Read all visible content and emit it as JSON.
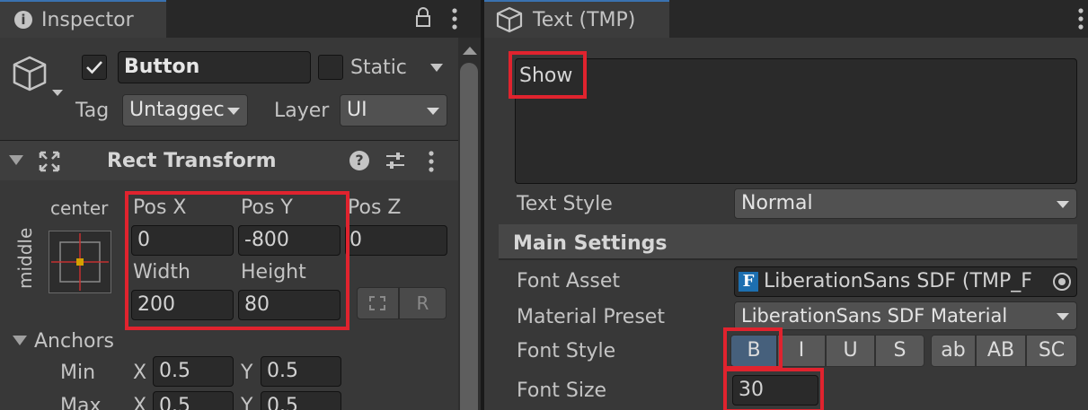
{
  "left_panel": {
    "tab_title": "Inspector",
    "object_name": "Button",
    "static_label": "Static",
    "tag_label": "Tag",
    "tag_value": "Untaggec",
    "layer_label": "Layer",
    "layer_value": "UI",
    "component_title": "Rect Transform",
    "anchor_h_label": "center",
    "anchor_v_label": "middle",
    "posx_label": "Pos X",
    "posx_value": "0",
    "posy_label": "Pos Y",
    "posy_value": "-800",
    "posz_label": "Pos Z",
    "posz_value": "0",
    "width_label": "Width",
    "width_value": "200",
    "height_label": "Height",
    "height_value": "80",
    "r_button_label": "R",
    "anchors_label": "Anchors",
    "min_label": "Min",
    "min_x_label": "X",
    "min_x_value": "0.5",
    "min_y_label": "Y",
    "min_y_value": "0.5",
    "max_label": "Max",
    "max_x_label": "X",
    "max_x_value": "0.5",
    "max_y_label": "Y",
    "max_y_value": "0.5"
  },
  "right_panel": {
    "tab_title": "Text (TMP)",
    "text_content": "Show",
    "text_style_label": "Text Style",
    "text_style_value": "Normal",
    "main_settings_label": "Main Settings",
    "font_asset_label": "Font Asset",
    "font_asset_icon_glyph": "F",
    "font_asset_value": "LiberationSans SDF (TMP_F",
    "material_preset_label": "Material Preset",
    "material_preset_value": "LiberationSans SDF Material",
    "font_style_label": "Font Style",
    "style_buttons": [
      "B",
      "I",
      "U",
      "S",
      "ab",
      "AB",
      "SC"
    ],
    "font_size_label": "Font Size",
    "font_size_value": "30"
  },
  "colors": {
    "highlight": "#e0232e",
    "panel_bg": "#383838",
    "active_bold": "#46607c"
  }
}
